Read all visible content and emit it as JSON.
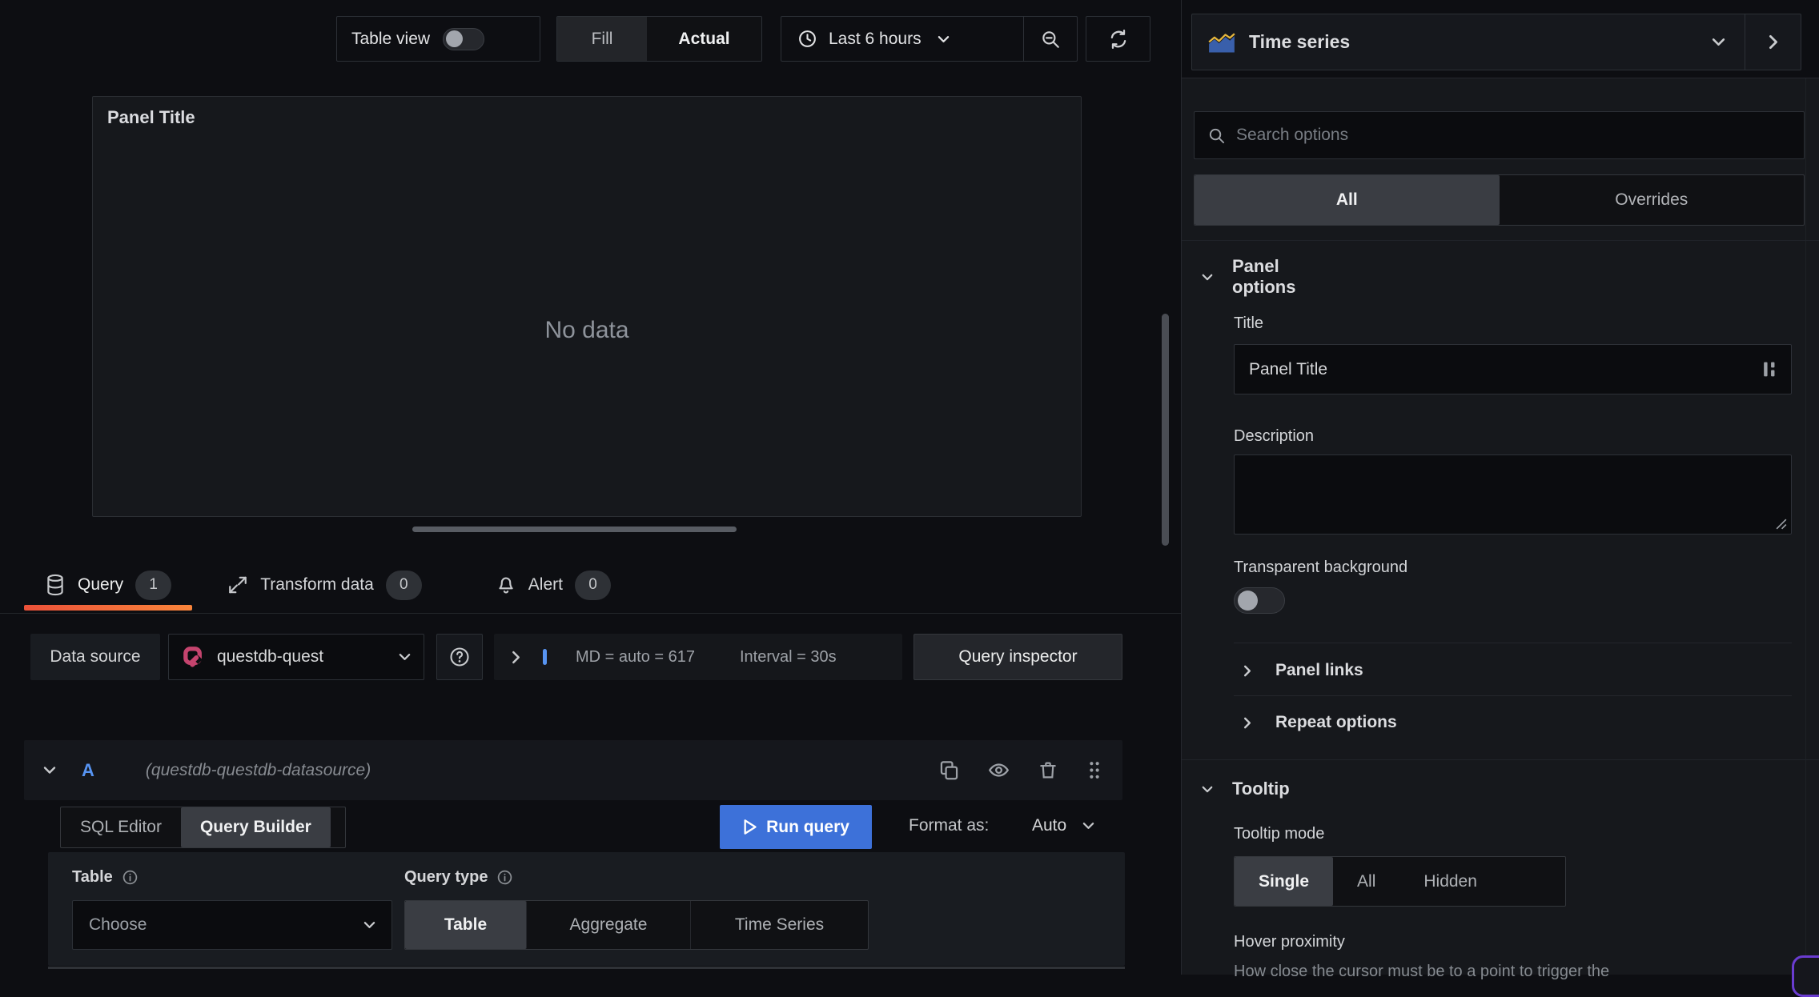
{
  "toolbar": {
    "table_view_label": "Table view",
    "fill_label": "Fill",
    "actual_label": "Actual",
    "time_range_label": "Last 6 hours"
  },
  "panel": {
    "title": "Panel Title",
    "no_data_text": "No data"
  },
  "tabs": [
    {
      "label": "Query",
      "count": "1"
    },
    {
      "label": "Transform data",
      "count": "0"
    },
    {
      "label": "Alert",
      "count": "0"
    }
  ],
  "datasource_row": {
    "label": "Data source",
    "selected_datasource": "questdb-quest",
    "max_data_points_text": "MD = auto = 617",
    "interval_text": "Interval = 30s",
    "query_inspector_label": "Query inspector"
  },
  "query_editor": {
    "ref_id": "A",
    "datasource_hint": "(questdb-questdb-datasource)",
    "sql_editor_label": "SQL Editor",
    "query_builder_label": "Query Builder",
    "run_query_label": "Run query",
    "format_as_label": "Format as:",
    "format_value": "Auto",
    "table_label": "Table",
    "table_value": "Choose",
    "query_type_label": "Query type",
    "query_type_options": [
      "Table",
      "Aggregate",
      "Time Series"
    ]
  },
  "sidebar": {
    "visualization_name": "Time series",
    "search_placeholder": "Search options",
    "filter_tabs": [
      "All",
      "Overrides"
    ],
    "panel_options": {
      "heading": "Panel options",
      "title_label": "Title",
      "title_value": "Panel Title",
      "description_label": "Description",
      "transparent_label": "Transparent background",
      "panel_links_label": "Panel links",
      "repeat_options_label": "Repeat options"
    },
    "tooltip": {
      "heading": "Tooltip",
      "mode_label": "Tooltip mode",
      "modes": [
        "Single",
        "All",
        "Hidden"
      ],
      "hover_label": "Hover proximity",
      "hover_description": "How close the cursor must be to a point to trigger the"
    }
  }
}
